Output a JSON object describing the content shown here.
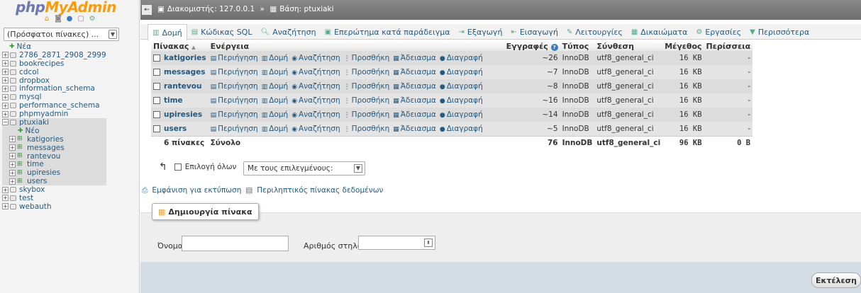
{
  "logo": {
    "part1": "php",
    "part2": "MyAdmin"
  },
  "nav": {
    "recent_select": "(Πρόσφατοι πίνακες) ...",
    "new_label": "Νέα",
    "databases": [
      "2786_2871_2908_2999",
      "bookrecipes",
      "cdcol",
      "dropbox",
      "information_schema",
      "mysql",
      "performance_schema",
      "phpmyadmin"
    ],
    "current_db": "ptuxiaki",
    "current_new": "Νέο",
    "current_tables": [
      "katigories",
      "messages",
      "rantevou",
      "time",
      "upiresies",
      "users"
    ],
    "databases_after": [
      "skybox",
      "test",
      "webauth"
    ]
  },
  "topbar": {
    "server_label": "Διακομιστής: 127.0.0.1",
    "sep": "»",
    "db_label": "Βάση: ptuxiaki"
  },
  "tabs": [
    {
      "label": "Δομή",
      "icon": "structure-icon"
    },
    {
      "label": "Κώδικας SQL",
      "icon": "sql-icon"
    },
    {
      "label": "Αναζήτηση",
      "icon": "search-icon"
    },
    {
      "label": "Επερώτημα κατά παράδειγμα",
      "icon": "query-icon"
    },
    {
      "label": "Εξαγωγή",
      "icon": "export-icon"
    },
    {
      "label": "Εισαγωγή",
      "icon": "import-icon"
    },
    {
      "label": "Λειτουργίες",
      "icon": "wrench-icon"
    },
    {
      "label": "Δικαιώματα",
      "icon": "privileges-icon"
    },
    {
      "label": "Εργασίες",
      "icon": "routines-icon"
    },
    {
      "label": "Περισσότερα",
      "icon": "triangle-down-icon"
    }
  ],
  "table": {
    "headers": {
      "table": "Πίνακας",
      "sort": "▲",
      "action": "Ενέργεια",
      "rows": "Εγγραφές",
      "info": "?",
      "type": "Τύπος",
      "collation": "Σύνθεση",
      "size": "Μέγεθος",
      "overhead": "Περίσσεια"
    },
    "actions": {
      "browse": "Περιήγηση",
      "structure": "Δομή",
      "search": "Αναζήτηση",
      "insert": "Προσθήκη",
      "empty": "Άδειασμα",
      "drop": "Διαγραφή"
    },
    "rows": [
      {
        "name": "katigories",
        "rows": "~26",
        "type": "InnoDB",
        "collation": "utf8_general_ci",
        "size": "16 KB",
        "overhead": "-"
      },
      {
        "name": "messages",
        "rows": "~7",
        "type": "InnoDB",
        "collation": "utf8_general_ci",
        "size": "16 KB",
        "overhead": "-"
      },
      {
        "name": "rantevou",
        "rows": "~8",
        "type": "InnoDB",
        "collation": "utf8_general_ci",
        "size": "16 KB",
        "overhead": "-"
      },
      {
        "name": "time",
        "rows": "~16",
        "type": "InnoDB",
        "collation": "utf8_general_ci",
        "size": "16 KB",
        "overhead": "-"
      },
      {
        "name": "upiresies",
        "rows": "~14",
        "type": "InnoDB",
        "collation": "utf8_general_ci",
        "size": "16 KB",
        "overhead": "-"
      },
      {
        "name": "users",
        "rows": "~5",
        "type": "InnoDB",
        "collation": "utf8_general_ci",
        "size": "16 KB",
        "overhead": "-"
      }
    ],
    "total": {
      "count": "6 πίνακες",
      "label": "Σύνολο",
      "rows": "76",
      "type": "InnoDB",
      "collation": "utf8_general_ci",
      "size": "96 KB",
      "overhead": "0 B"
    }
  },
  "checkall": {
    "label": "Επιλογή όλων",
    "with_selected": "Με τους επιλεγμένους:"
  },
  "links": {
    "print": "Εμφάνιση για εκτύπωση",
    "dictionary": "Περιληπτικός πίνακας δεδομένων"
  },
  "create": {
    "legend": "Δημιουργία πίνακα",
    "name_label": "Όνομα:",
    "cols_label": "Αριθμός στηλών:",
    "go": "Εκτέλεση"
  }
}
